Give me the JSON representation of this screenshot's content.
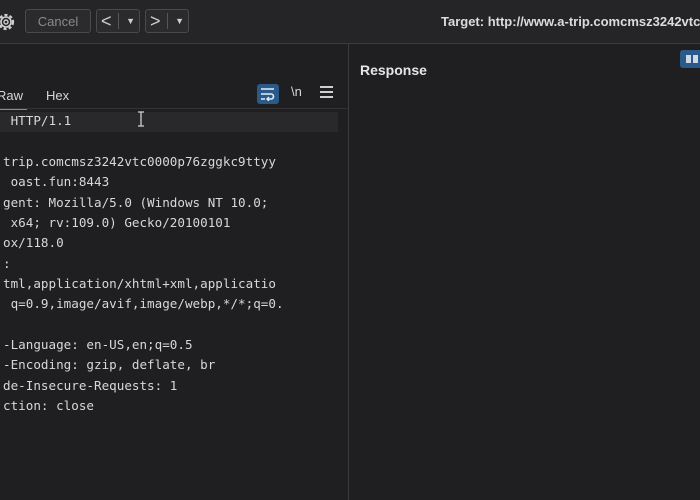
{
  "toolbar": {
    "cancel_label": "Cancel",
    "back_arrow": "<",
    "forward_arrow": ">",
    "dropdown_glyph": "▼",
    "target_text": "Target: http://www.a-trip.comcmsz3242vtc"
  },
  "request": {
    "tabs": [
      {
        "label": "Raw",
        "active": true
      },
      {
        "label": "Hex",
        "active": false
      }
    ],
    "newline_label": "\\n",
    "lines": [
      " HTTP/1.1",
      "",
      "trip.comcmsz3242vtc0000p76zggkc9ttyy",
      " oast.fun:8443",
      "gent: Mozilla/5.0 (Windows NT 10.0;",
      " x64; rv:109.0) Gecko/20100101",
      "ox/118.0",
      ":",
      "tml,application/xhtml+xml,applicatio",
      " q=0.9,image/avif,image/webp,*/*;q=0.",
      "",
      "-Language: en-US,en;q=0.5",
      "-Encoding: gzip, deflate, br",
      "de-Insecure-Requests: 1",
      "ction: close"
    ]
  },
  "response": {
    "title": "Response"
  },
  "colors": {
    "accent_tab": "#e8702a",
    "button_blue": "#2a5a8a",
    "background": "#1f1f21"
  }
}
